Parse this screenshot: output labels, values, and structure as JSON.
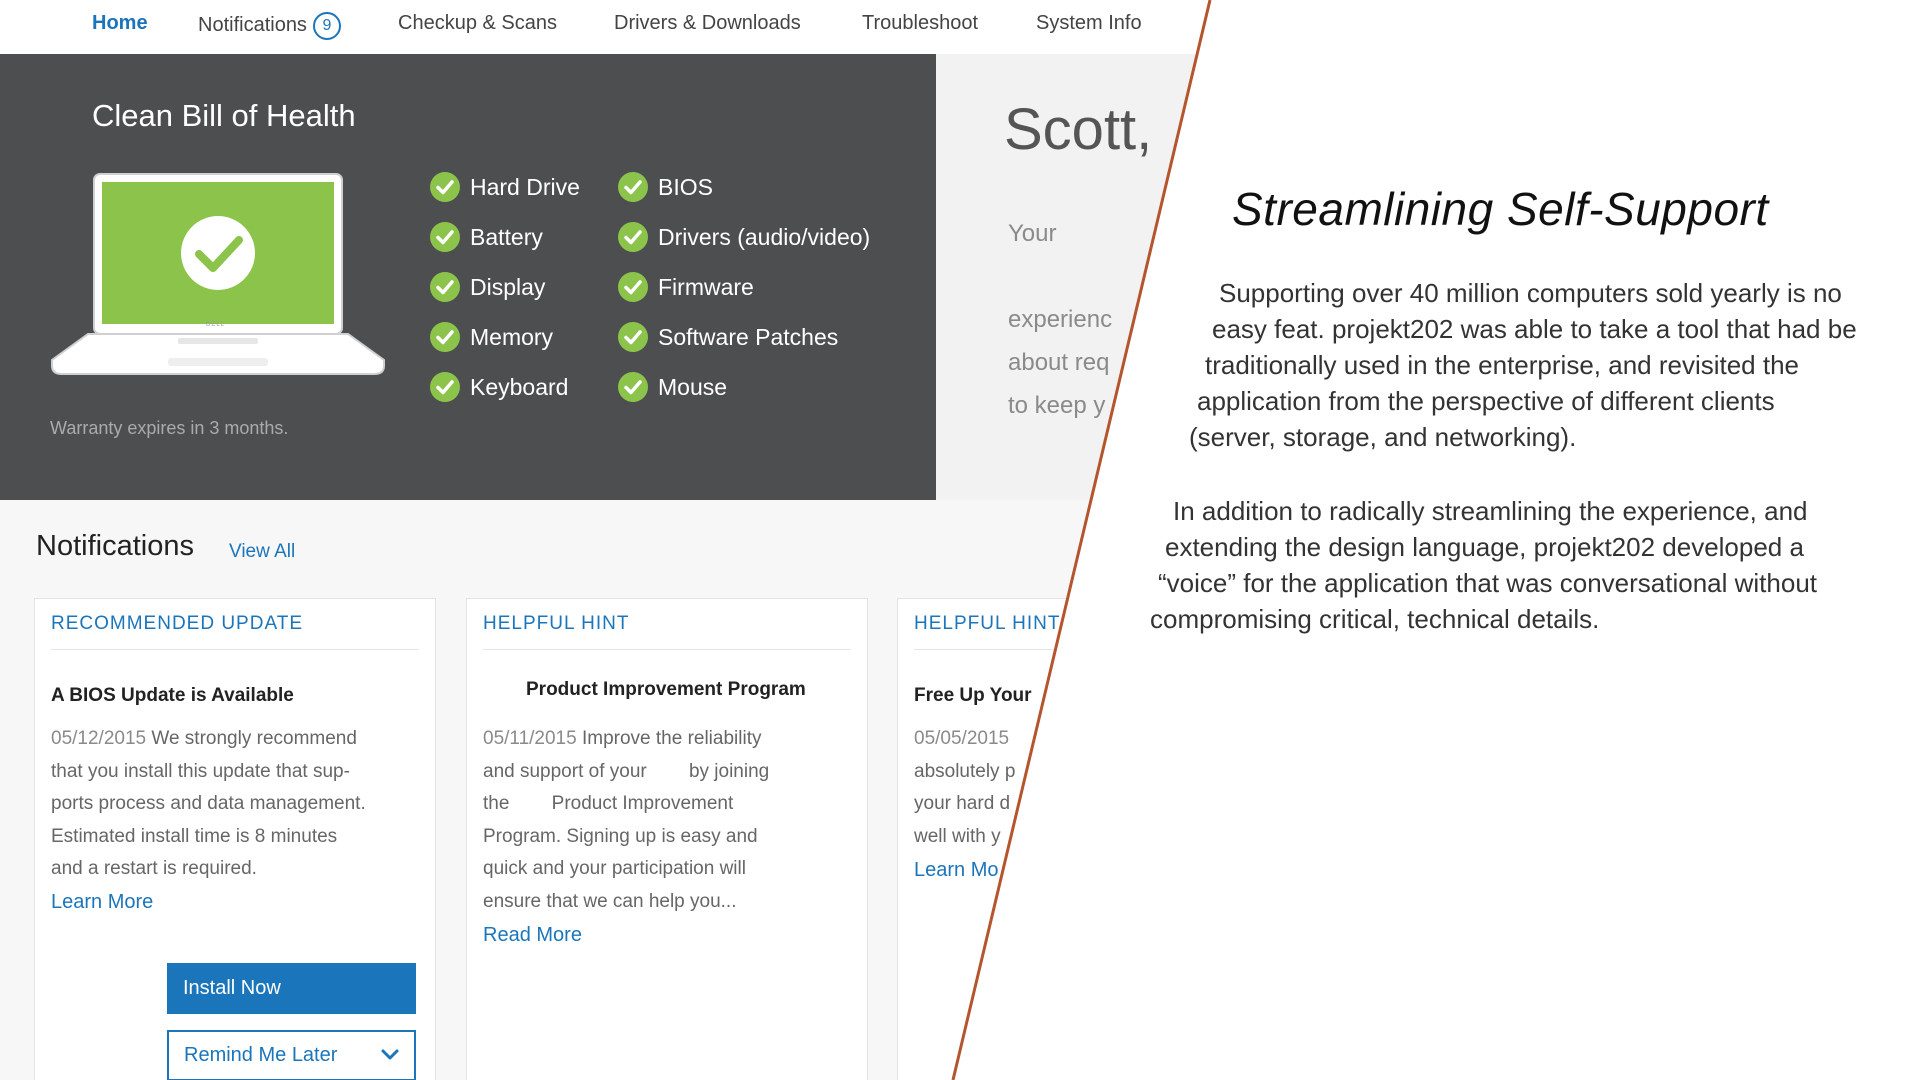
{
  "nav": {
    "items": [
      {
        "label": "Home",
        "active": true
      },
      {
        "label": "Notifications",
        "badge": "9"
      },
      {
        "label": "Checkup & Scans"
      },
      {
        "label": "Drivers & Downloads"
      },
      {
        "label": "Troubleshoot"
      },
      {
        "label": "System Info"
      }
    ]
  },
  "hero": {
    "title": "Clean Bill of Health",
    "laptop_brand": "DELL",
    "warranty": "Warranty expires in 3 months.",
    "checks_left": [
      "Hard Drive",
      "Battery",
      "Display",
      "Memory",
      "Keyboard"
    ],
    "checks_right": [
      "BIOS",
      "Drivers (audio/video)",
      "Firmware",
      "Software Patches",
      "Mouse"
    ],
    "check_color": "#8cc34a"
  },
  "greeting": {
    "name": "Scott, ",
    "lines": [
      "Your",
      "experienc",
      "about req",
      "to keep y"
    ]
  },
  "notifications": {
    "title": "Notifications",
    "view_all": "View All",
    "cards": [
      {
        "header": "RECOMMENDED UPDATE",
        "title": "A BIOS Update is Available",
        "lines": [
          {
            "date": "05/12/2015",
            "text": " We strongly recommend"
          },
          {
            "text": "that you install this update that sup-"
          },
          {
            "text": "ports process and data management."
          },
          {
            "text": "Estimated install time is 8 minutes"
          },
          {
            "text": "and a restart is required."
          }
        ],
        "link": "Learn More",
        "primary_button": "Install Now",
        "secondary_button": "Remind Me Later"
      },
      {
        "header": "HELPFUL HINT",
        "title": "Product Improvement Program",
        "lines": [
          {
            "date": "05/11/2015",
            "text": " Improve the reliability"
          },
          {
            "text": "and support of your        by joining"
          },
          {
            "text": "the        Product Improvement"
          },
          {
            "text": "Program. Signing up is easy and"
          },
          {
            "text": "quick and your participation will"
          },
          {
            "text": "ensure that we can help you..."
          }
        ],
        "link": "Read More"
      },
      {
        "header": "HELPFUL HINT",
        "title": "Free Up Your",
        "lines": [
          {
            "date": "05/05/2015",
            "text": ""
          },
          {
            "text": "absolutely p"
          },
          {
            "text": "your hard d"
          },
          {
            "text": "well with y"
          }
        ],
        "link": "Learn Mo"
      }
    ]
  },
  "accent_color": "#1b75bb",
  "divider_color": "#b5552e",
  "case_study": {
    "title": "Streamlining Self-Support",
    "paragraph1": [
      "Supporting over 40 million computers sold yearly is no",
      "easy feat.  projekt202 was able to take a tool that had be",
      "traditionally used in the enterprise, and revisited the",
      "application from the perspective of different clients",
      "(server, storage, and networking)."
    ],
    "paragraph2": [
      "In addition to radically streamlining the experience, and",
      "extending the design language, projekt202 developed a",
      "“voice” for the application that was conversational without",
      "compromising critical, technical details."
    ]
  }
}
